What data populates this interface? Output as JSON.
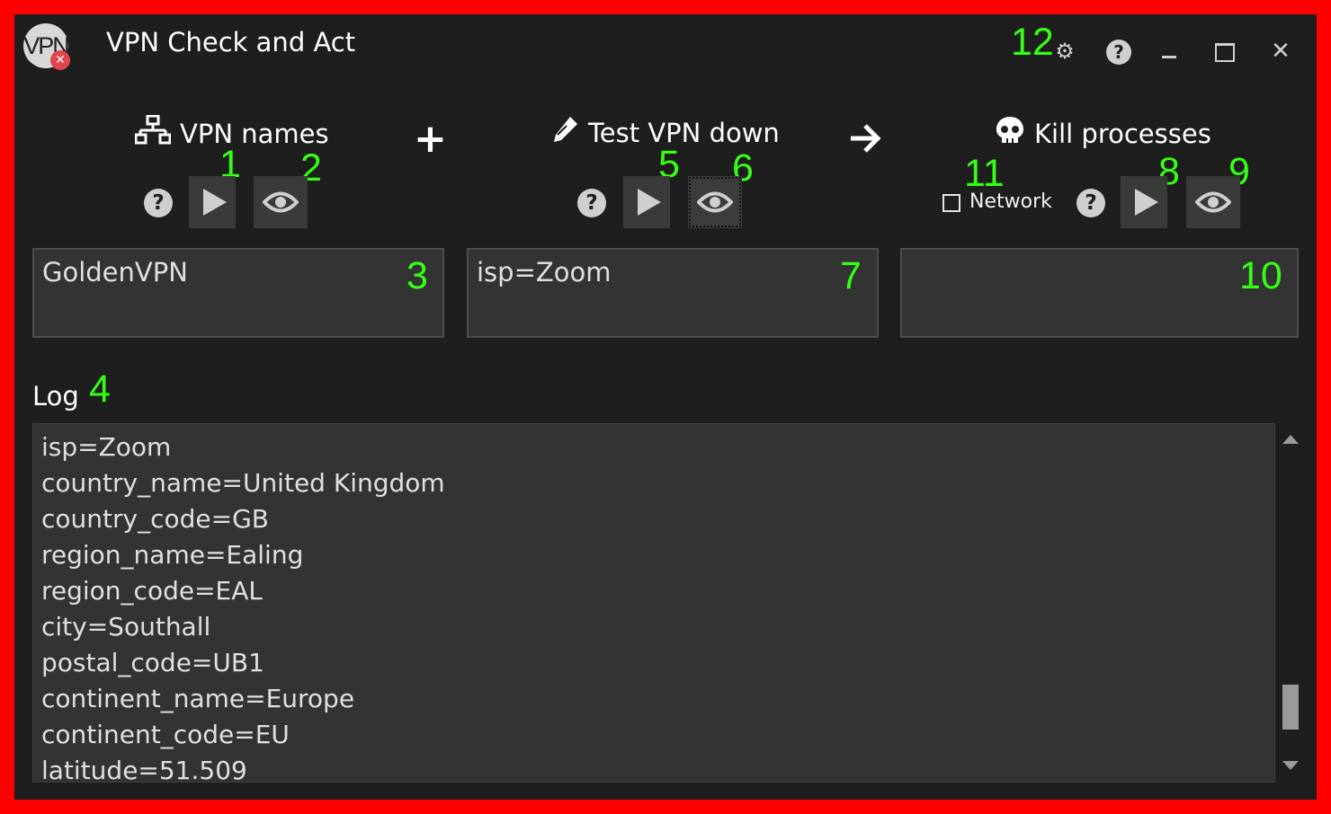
{
  "window": {
    "title": "VPN Check and Act",
    "logo_text": "VPN",
    "title_controls": [
      "gear-icon",
      "help-icon",
      "minimize-icon",
      "maximize-icon",
      "close-icon"
    ]
  },
  "sections": {
    "vpn_names": {
      "heading": "VPN names",
      "icon": "network-icon",
      "value": "GoldenVPN"
    },
    "plus": "+",
    "test_vpn": {
      "heading": "Test VPN down",
      "icon": "eyedropper-icon",
      "value": "isp=Zoom"
    },
    "arrow": "→",
    "kill": {
      "heading": "Kill processes",
      "icon": "skull-icon",
      "value": "",
      "network_label": "Network",
      "network_checked": false
    }
  },
  "log": {
    "label": "Log",
    "lines": [
      "isp=Zoom",
      "country_name=United Kingdom",
      "country_code=GB",
      "region_name=Ealing",
      "region_code=EAL",
      "city=Southall",
      "postal_code=UB1",
      "continent_name=Europe",
      "continent_code=EU",
      "latitude=51.509"
    ]
  },
  "annotations": {
    "a1": "1",
    "a2": "2",
    "a3": "3",
    "a4": "4",
    "a5": "5",
    "a6": "6",
    "a7": "7",
    "a8": "8",
    "a9": "9",
    "a10": "10",
    "a11": "11",
    "a12": "12"
  },
  "colors": {
    "background": "#1e1e1e",
    "panel": "#333333",
    "annotation": "#35ff14",
    "frame": "#ff0000"
  }
}
